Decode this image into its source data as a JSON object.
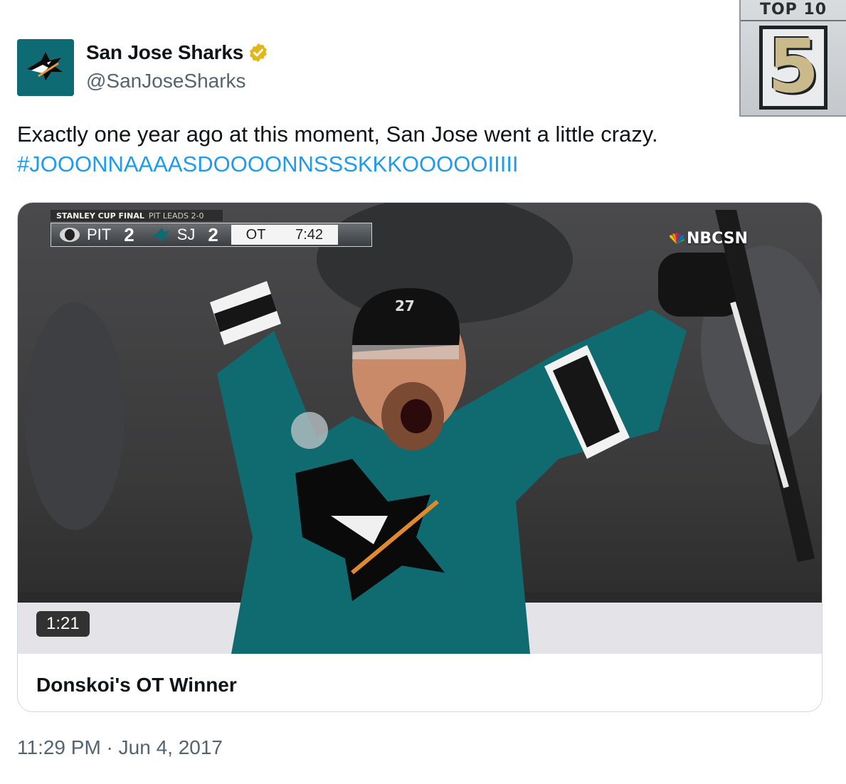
{
  "author": {
    "display_name": "San Jose Sharks",
    "handle": "@SanJoseSharks",
    "verified": true,
    "avatar_icon": "sharks-logo-icon",
    "avatar_color": "#0e6a73"
  },
  "overlay_badge": {
    "label": "TOP 10",
    "number": "5"
  },
  "tweet": {
    "text": "Exactly one year ago at this moment, San Jose went a little crazy.",
    "hashtag": "#JOOONNAAAASDOOOONNSSSKKKOOOOOIIIII",
    "hashtag_color": "#1d9bf0"
  },
  "media_card": {
    "duration": "1:21",
    "title": "Donskoi's OT Winner",
    "scorebug": {
      "event": "STANLEY CUP FINAL",
      "series": "PIT LEADS 2-0",
      "home_team": "PIT",
      "home_score": "2",
      "away_team": "SJ",
      "away_score": "2",
      "period": "OT",
      "clock": "7:42"
    },
    "network": "NBCSN",
    "jersey_number": "27"
  },
  "timestamp": "11:29 PM · Jun 4, 2017"
}
